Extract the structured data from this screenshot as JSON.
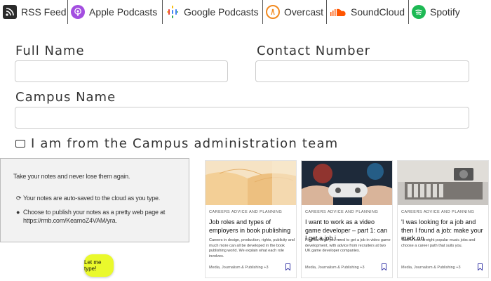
{
  "podcast_links": [
    {
      "label": "RSS Feed",
      "icon": "rss-icon",
      "color": "#2b2b2b"
    },
    {
      "label": "Apple Podcasts",
      "icon": "apple-podcasts-icon",
      "color": "#a34ee0"
    },
    {
      "label": "Google Podcasts",
      "icon": "google-podcasts-icon",
      "color": "#4285f4"
    },
    {
      "label": "Overcast",
      "icon": "overcast-icon",
      "color": "#f28a20"
    },
    {
      "label": "SoundCloud",
      "icon": "soundcloud-icon",
      "color": "#ff5500"
    },
    {
      "label": "Spotify",
      "icon": "spotify-icon",
      "color": "#1db954"
    }
  ],
  "form": {
    "full_name_label": "Full Name",
    "contact_label": "Contact Number",
    "campus_label": "Campus Name",
    "admin_checkbox_label": "I am from the Campus administration team"
  },
  "notes": {
    "tagline": "Take your notes and never lose them again.",
    "item1": "Your notes are auto-saved to the cloud as you type.",
    "item2": "Choose to publish your notes as a pretty web page at https://rmb.com/KeamoZ4VAM/yra.",
    "button": "Let me type!",
    "button_color": "#eaf92c"
  },
  "cards": [
    {
      "tag": "CAREERS ADVICE AND PLANNING",
      "title": "Job roles and types of employers in book publishing",
      "desc": "Careers in design, production, rights, publicity and much more can all be developed in the book publishing world. We explain what each role involves.",
      "foot": "Media, Journalism & Publishing +3"
    },
    {
      "tag": "CAREERS ADVICE AND PLANNING",
      "title": "I want to work as a video game developer – part 1: can I get a job i...",
      "desc": "Find out what you need to get a job in video game development, with advice from recruiters at two UK game developer companies.",
      "foot": "Media, Journalism & Publishing +3"
    },
    {
      "tag": "CAREERS ADVICE AND PLANNING",
      "title": "'I was looking for a job and then I found a job: make your mark on...",
      "desc": "Take a look at eight popular music jobs and choose a career path that suits you.",
      "foot": "Media, Journalism & Publishing +3"
    }
  ]
}
